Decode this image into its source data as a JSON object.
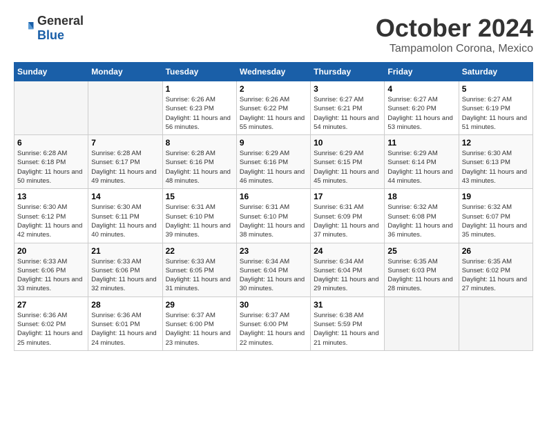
{
  "header": {
    "logo_general": "General",
    "logo_blue": "Blue",
    "month_title": "October 2024",
    "location": "Tampamolon Corona, Mexico"
  },
  "calendar": {
    "days_of_week": [
      "Sunday",
      "Monday",
      "Tuesday",
      "Wednesday",
      "Thursday",
      "Friday",
      "Saturday"
    ],
    "weeks": [
      [
        {
          "day": "",
          "info": ""
        },
        {
          "day": "",
          "info": ""
        },
        {
          "day": "1",
          "info": "Sunrise: 6:26 AM\nSunset: 6:23 PM\nDaylight: 11 hours and 56 minutes."
        },
        {
          "day": "2",
          "info": "Sunrise: 6:26 AM\nSunset: 6:22 PM\nDaylight: 11 hours and 55 minutes."
        },
        {
          "day": "3",
          "info": "Sunrise: 6:27 AM\nSunset: 6:21 PM\nDaylight: 11 hours and 54 minutes."
        },
        {
          "day": "4",
          "info": "Sunrise: 6:27 AM\nSunset: 6:20 PM\nDaylight: 11 hours and 53 minutes."
        },
        {
          "day": "5",
          "info": "Sunrise: 6:27 AM\nSunset: 6:19 PM\nDaylight: 11 hours and 51 minutes."
        }
      ],
      [
        {
          "day": "6",
          "info": "Sunrise: 6:28 AM\nSunset: 6:18 PM\nDaylight: 11 hours and 50 minutes."
        },
        {
          "day": "7",
          "info": "Sunrise: 6:28 AM\nSunset: 6:17 PM\nDaylight: 11 hours and 49 minutes."
        },
        {
          "day": "8",
          "info": "Sunrise: 6:28 AM\nSunset: 6:16 PM\nDaylight: 11 hours and 48 minutes."
        },
        {
          "day": "9",
          "info": "Sunrise: 6:29 AM\nSunset: 6:16 PM\nDaylight: 11 hours and 46 minutes."
        },
        {
          "day": "10",
          "info": "Sunrise: 6:29 AM\nSunset: 6:15 PM\nDaylight: 11 hours and 45 minutes."
        },
        {
          "day": "11",
          "info": "Sunrise: 6:29 AM\nSunset: 6:14 PM\nDaylight: 11 hours and 44 minutes."
        },
        {
          "day": "12",
          "info": "Sunrise: 6:30 AM\nSunset: 6:13 PM\nDaylight: 11 hours and 43 minutes."
        }
      ],
      [
        {
          "day": "13",
          "info": "Sunrise: 6:30 AM\nSunset: 6:12 PM\nDaylight: 11 hours and 42 minutes."
        },
        {
          "day": "14",
          "info": "Sunrise: 6:30 AM\nSunset: 6:11 PM\nDaylight: 11 hours and 40 minutes."
        },
        {
          "day": "15",
          "info": "Sunrise: 6:31 AM\nSunset: 6:10 PM\nDaylight: 11 hours and 39 minutes."
        },
        {
          "day": "16",
          "info": "Sunrise: 6:31 AM\nSunset: 6:10 PM\nDaylight: 11 hours and 38 minutes."
        },
        {
          "day": "17",
          "info": "Sunrise: 6:31 AM\nSunset: 6:09 PM\nDaylight: 11 hours and 37 minutes."
        },
        {
          "day": "18",
          "info": "Sunrise: 6:32 AM\nSunset: 6:08 PM\nDaylight: 11 hours and 36 minutes."
        },
        {
          "day": "19",
          "info": "Sunrise: 6:32 AM\nSunset: 6:07 PM\nDaylight: 11 hours and 35 minutes."
        }
      ],
      [
        {
          "day": "20",
          "info": "Sunrise: 6:33 AM\nSunset: 6:06 PM\nDaylight: 11 hours and 33 minutes."
        },
        {
          "day": "21",
          "info": "Sunrise: 6:33 AM\nSunset: 6:06 PM\nDaylight: 11 hours and 32 minutes."
        },
        {
          "day": "22",
          "info": "Sunrise: 6:33 AM\nSunset: 6:05 PM\nDaylight: 11 hours and 31 minutes."
        },
        {
          "day": "23",
          "info": "Sunrise: 6:34 AM\nSunset: 6:04 PM\nDaylight: 11 hours and 30 minutes."
        },
        {
          "day": "24",
          "info": "Sunrise: 6:34 AM\nSunset: 6:04 PM\nDaylight: 11 hours and 29 minutes."
        },
        {
          "day": "25",
          "info": "Sunrise: 6:35 AM\nSunset: 6:03 PM\nDaylight: 11 hours and 28 minutes."
        },
        {
          "day": "26",
          "info": "Sunrise: 6:35 AM\nSunset: 6:02 PM\nDaylight: 11 hours and 27 minutes."
        }
      ],
      [
        {
          "day": "27",
          "info": "Sunrise: 6:36 AM\nSunset: 6:02 PM\nDaylight: 11 hours and 25 minutes."
        },
        {
          "day": "28",
          "info": "Sunrise: 6:36 AM\nSunset: 6:01 PM\nDaylight: 11 hours and 24 minutes."
        },
        {
          "day": "29",
          "info": "Sunrise: 6:37 AM\nSunset: 6:00 PM\nDaylight: 11 hours and 23 minutes."
        },
        {
          "day": "30",
          "info": "Sunrise: 6:37 AM\nSunset: 6:00 PM\nDaylight: 11 hours and 22 minutes."
        },
        {
          "day": "31",
          "info": "Sunrise: 6:38 AM\nSunset: 5:59 PM\nDaylight: 11 hours and 21 minutes."
        },
        {
          "day": "",
          "info": ""
        },
        {
          "day": "",
          "info": ""
        }
      ]
    ]
  }
}
